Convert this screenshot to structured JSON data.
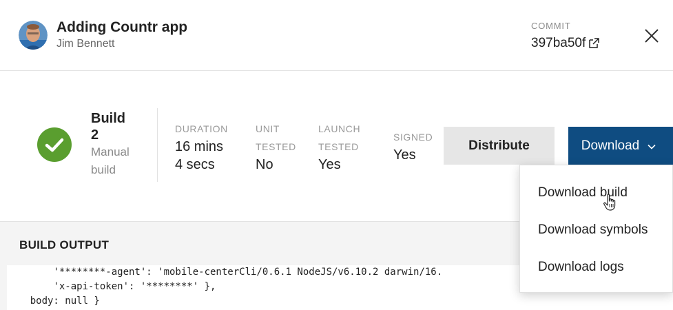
{
  "header": {
    "title": "Adding Countr app",
    "author": "Jim Bennett",
    "commit_label": "COMMIT",
    "commit_hash": "397ba50f"
  },
  "build": {
    "title": "Build",
    "number": "2",
    "trigger": "Manual build",
    "status": "success",
    "stats": [
      {
        "label_line1": "DURATION",
        "label_line2": "",
        "value_line1": "16 mins",
        "value_line2": "4 secs"
      },
      {
        "label_line1": "UNIT",
        "label_line2": "TESTED",
        "value_line1": "No",
        "value_line2": ""
      },
      {
        "label_line1": "LAUNCH",
        "label_line2": "TESTED",
        "value_line1": "Yes",
        "value_line2": ""
      },
      {
        "label_line1": "SIGNED",
        "label_line2": "",
        "value_line1": "Yes",
        "value_line2": ""
      }
    ],
    "distribute_label": "Distribute",
    "download_label": "Download"
  },
  "dropdown": {
    "items": [
      "Download build",
      "Download symbols",
      "Download logs"
    ]
  },
  "output": {
    "title": "BUILD OUTPUT",
    "lines": [
      "        '********-agent': 'mobile-centerCli/0.6.1 NodeJS/v6.10.2 darwin/16.",
      "        'x-api-token': '********' },",
      "    body: null }"
    ]
  },
  "colors": {
    "accent": "#0f4c81",
    "success": "#5a9e2f",
    "distribute_bg": "#e6e6e6",
    "output_bg": "#f4f4f4"
  },
  "icons": {
    "status": "check-circle-icon",
    "commit_link": "external-link-icon",
    "close": "close-icon",
    "download_caret": "chevron-down-icon",
    "cursor": "hand-pointer-icon"
  }
}
